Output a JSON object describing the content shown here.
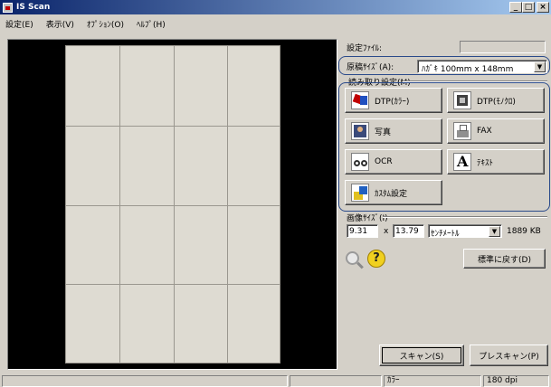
{
  "window": {
    "title": "IS Scan",
    "min": "_",
    "max": "□",
    "close": "×"
  },
  "menu": [
    "設定(E)",
    "表示(V)",
    "ｵﾌﾟｼｮﾝ(O)",
    "ﾍﾙﾌﾟ(H)"
  ],
  "settings_file": {
    "label": "設定ﾌｧｲﾙ:",
    "value": ""
  },
  "doc_size": {
    "label": "原稿ｻｲｽﾞ(A):",
    "value": "ﾊｶﾞｷ 100mm x 148mm"
  },
  "read_settings": {
    "label": "読み取り設定(M)",
    "buttons": [
      {
        "label": "DTP(ｶﾗｰ)",
        "icon": "dtp-color-icon"
      },
      {
        "label": "DTP(ﾓﾉｸﾛ)",
        "icon": "dtp-mono-icon"
      },
      {
        "label": "写真",
        "icon": "photo-icon"
      },
      {
        "label": "FAX",
        "icon": "fax-icon"
      },
      {
        "label": "OCR",
        "icon": "ocr-icon"
      },
      {
        "label": "ﾃｷｽﾄ",
        "icon": "text-icon"
      },
      {
        "label": "ｶｽﾀﾑ設定",
        "icon": "custom-settings-icon"
      }
    ]
  },
  "image_size": {
    "label": "画像ｻｲｽﾞ(I)",
    "width": "9.31",
    "x": "x",
    "height": "13.79",
    "unit": "ｾﾝﾁﾒｰﾄﾙ",
    "filesize": "1889 KB"
  },
  "tools": {
    "zoom_icon": "magnifier-icon",
    "help_icon": "help-icon",
    "help_glyph": "?"
  },
  "reset_button": "標準に戻す(D)",
  "scan_button": "スキャン(S)",
  "prescan_button": "プレスキャン(P)",
  "status": {
    "mode": "ｶﾗｰ",
    "dpi": "180 dpi"
  },
  "colors": {
    "accent_outline": "#2a4a8a",
    "title_start": "#0a246a",
    "title_end": "#a6caf0"
  }
}
